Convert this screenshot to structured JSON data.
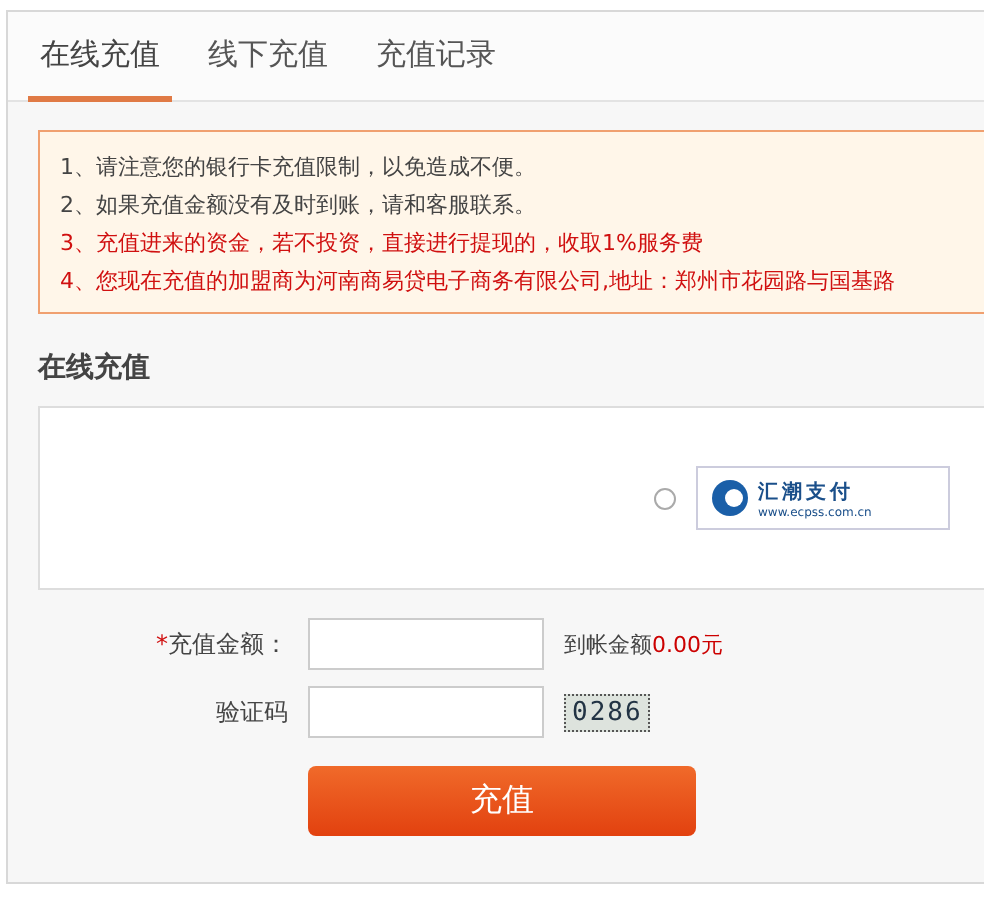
{
  "tabs": [
    {
      "label": "在线充值",
      "selected": true
    },
    {
      "label": "线下充值",
      "selected": false
    },
    {
      "label": "充值记录",
      "selected": false
    }
  ],
  "notices": [
    {
      "text": "1、请注意您的银行卡充值限制，以免造成不便。",
      "kind": "normal"
    },
    {
      "text": "2、如果充值金额没有及时到账，请和客服联系。",
      "kind": "normal"
    },
    {
      "text": "3、充值进来的资金，若不投资，直接进行提现的，收取1%服务费",
      "kind": "warning"
    },
    {
      "text": "4、您现在充值的加盟商为河南商易贷电子商务有限公司,地址：郑州市花园路与国基路",
      "kind": "warning"
    }
  ],
  "section_title": "在线充值",
  "payment": {
    "selected": false,
    "logo_name": "汇潮支付",
    "logo_url": "www.ecpss.com.cn"
  },
  "form": {
    "amount_label": "充值金额：",
    "required_mark": "*",
    "received_label": "到帐金额",
    "received_value": "0.00元",
    "captcha_label": "验证码",
    "captcha": "0286",
    "submit": "充值"
  }
}
